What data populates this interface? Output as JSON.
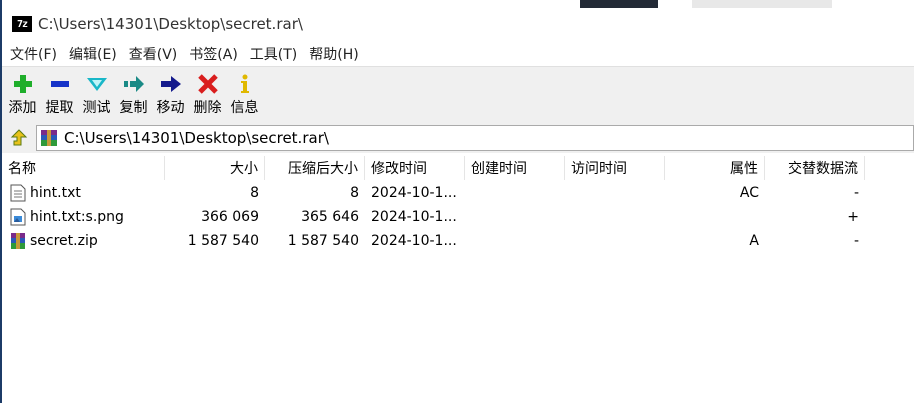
{
  "window": {
    "title": "C:\\Users\\14301\\Desktop\\secret.rar\\",
    "app_icon_text": "7z"
  },
  "menu": [
    "文件(F)",
    "编辑(E)",
    "查看(V)",
    "书签(A)",
    "工具(T)",
    "帮助(H)"
  ],
  "toolbar": [
    {
      "label": "添加",
      "icon": "add-icon",
      "color": "#1fae2b"
    },
    {
      "label": "提取",
      "icon": "extract-icon",
      "color": "#1633c8"
    },
    {
      "label": "测试",
      "icon": "test-icon",
      "color": "#19b7c8"
    },
    {
      "label": "复制",
      "icon": "copy-icon",
      "color": "#1a8a86"
    },
    {
      "label": "移动",
      "icon": "move-icon",
      "color": "#141a8c"
    },
    {
      "label": "删除",
      "icon": "delete-icon",
      "color": "#d91e1e"
    },
    {
      "label": "信息",
      "icon": "info-icon",
      "color": "#e0b800"
    }
  ],
  "address": {
    "path": "C:\\Users\\14301\\Desktop\\secret.rar\\"
  },
  "columns": [
    "名称",
    "大小",
    "压缩后大小",
    "修改时间",
    "创建时间",
    "访问时间",
    "属性",
    "交替数据流"
  ],
  "files": [
    {
      "name": "hint.txt",
      "size": "8",
      "packed": "8",
      "modified": "2024-10-1...",
      "created": "",
      "accessed": "",
      "attributes": "AC",
      "alt_streams": "-",
      "icon": "text-file-icon"
    },
    {
      "name": "hint.txt:s.png",
      "size": "366 069",
      "packed": "365 646",
      "modified": "2024-10-1...",
      "created": "",
      "accessed": "",
      "attributes": "",
      "alt_streams": "+",
      "icon": "image-file-icon"
    },
    {
      "name": "secret.zip",
      "size": "1 587 540",
      "packed": "1 587 540",
      "modified": "2024-10-1...",
      "created": "",
      "accessed": "",
      "attributes": "A",
      "alt_streams": "-",
      "icon": "archive-file-icon"
    }
  ]
}
